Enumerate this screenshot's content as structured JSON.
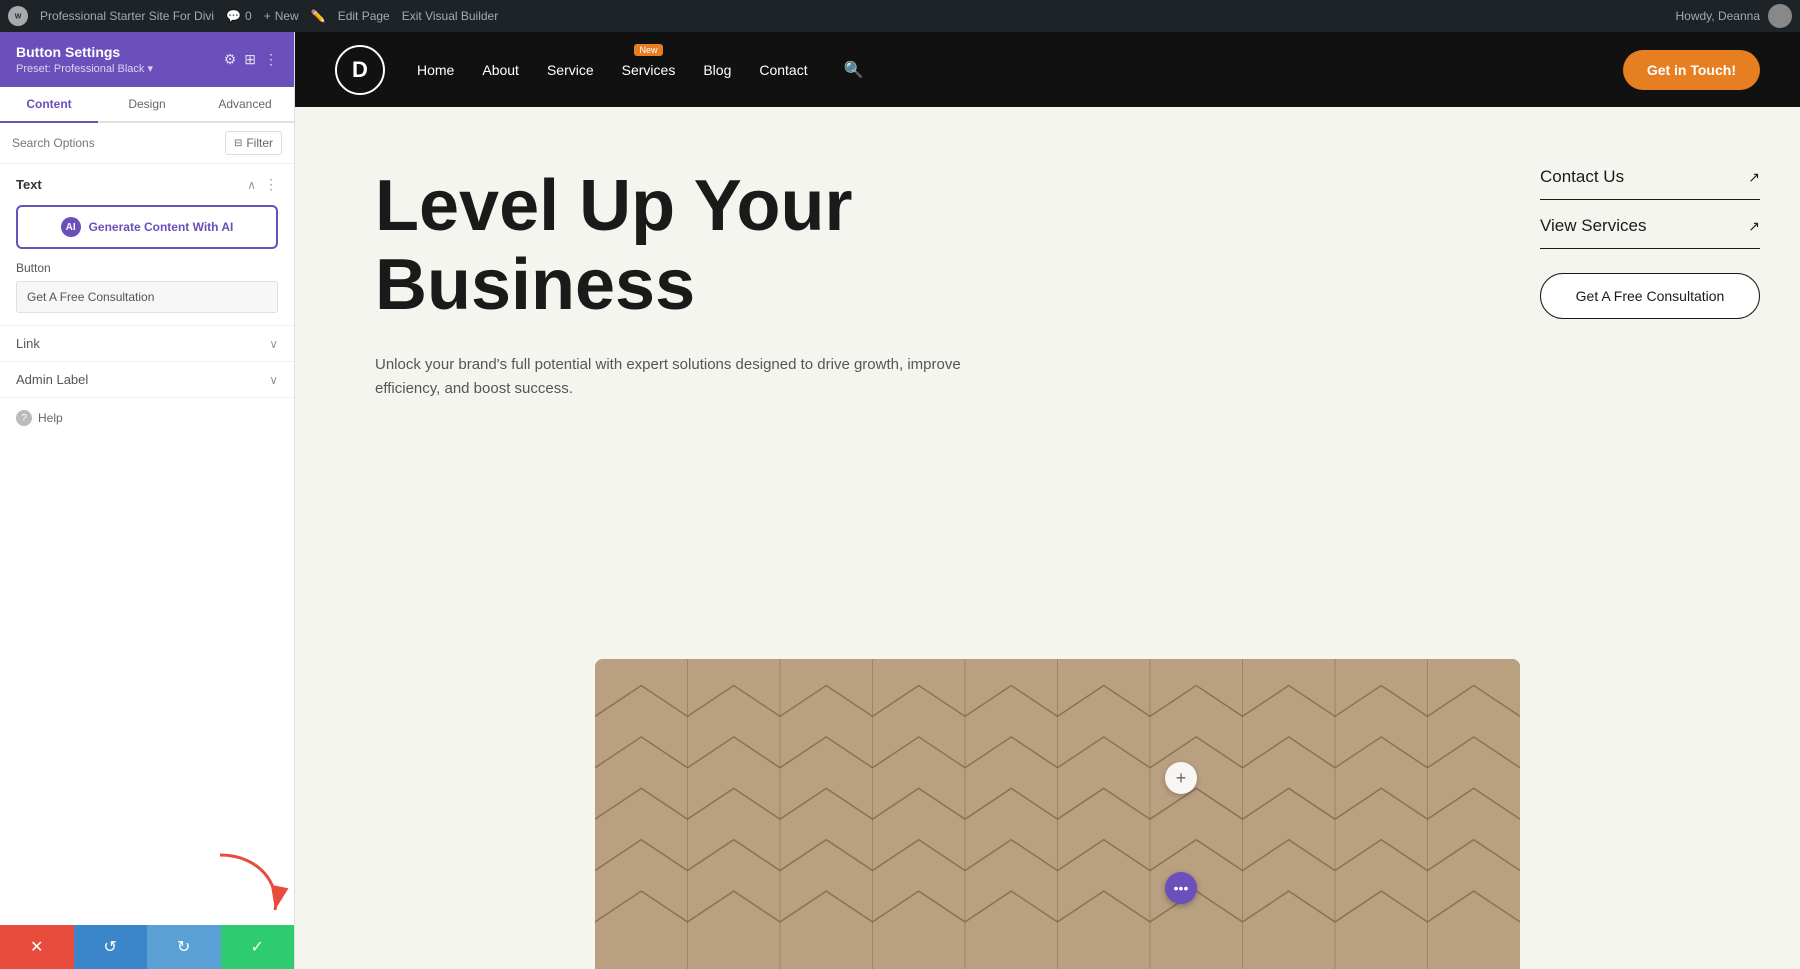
{
  "adminBar": {
    "wpLabel": "W",
    "siteName": "Professional Starter Site For Divi",
    "commentCount": "0",
    "newLabel": "New",
    "editPageLabel": "Edit Page",
    "exitBuilderLabel": "Exit Visual Builder",
    "howdy": "Howdy, Deanna"
  },
  "leftPanel": {
    "title": "Button Settings",
    "preset": "Preset: Professional Black ▾",
    "tabs": [
      "Content",
      "Design",
      "Advanced"
    ],
    "activeTab": "Content",
    "searchPlaceholder": "Search Options",
    "filterLabel": "Filter",
    "sections": {
      "text": {
        "label": "Text",
        "aiButton": "Generate Content With AI"
      },
      "button": {
        "label": "Button",
        "value": "Get A Free Consultation"
      },
      "link": {
        "label": "Link"
      },
      "adminLabel": {
        "label": "Admin Label"
      },
      "help": "Help"
    }
  },
  "bottomBar": {
    "cancelIcon": "✕",
    "undoIcon": "↺",
    "redoIcon": "↻",
    "saveIcon": "✓"
  },
  "siteHeader": {
    "logo": "D",
    "nav": [
      {
        "label": "Home"
      },
      {
        "label": "About",
        "new": false
      },
      {
        "label": "Service",
        "new": false
      },
      {
        "label": "Services",
        "new": true
      },
      {
        "label": "Blog",
        "new": false
      },
      {
        "label": "Contact",
        "new": false
      }
    ],
    "newBadge": "New",
    "getInTouch": "Get in Touch!"
  },
  "heroSection": {
    "heading1": "Level Up Your",
    "heading2": "Business",
    "subtext": "Unlock your brand's full potential with expert solutions designed to drive growth, improve efficiency, and boost success."
  },
  "rightSidebar": {
    "contactUs": "Contact Us",
    "viewServices": "View Services",
    "consultationBtn": "Get A Free Consultation"
  }
}
